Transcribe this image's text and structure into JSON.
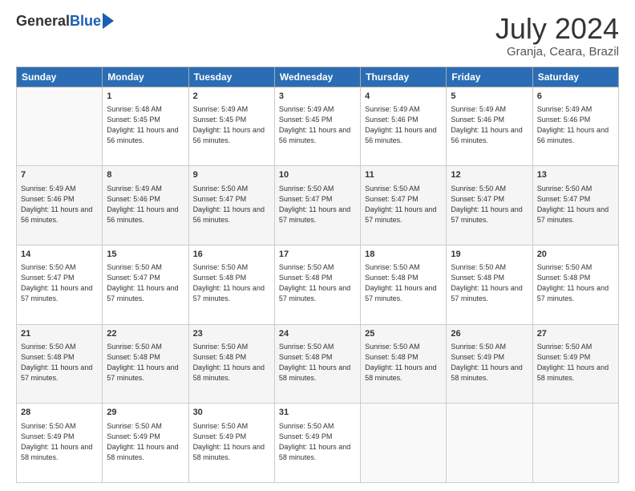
{
  "header": {
    "logo_general": "General",
    "logo_blue": "Blue",
    "month_title": "July 2024",
    "location": "Granja, Ceara, Brazil"
  },
  "days_of_week": [
    "Sunday",
    "Monday",
    "Tuesday",
    "Wednesday",
    "Thursday",
    "Friday",
    "Saturday"
  ],
  "weeks": [
    [
      {
        "day": "",
        "sunrise": "",
        "sunset": "",
        "daylight": ""
      },
      {
        "day": "1",
        "sunrise": "Sunrise: 5:48 AM",
        "sunset": "Sunset: 5:45 PM",
        "daylight": "Daylight: 11 hours and 56 minutes."
      },
      {
        "day": "2",
        "sunrise": "Sunrise: 5:49 AM",
        "sunset": "Sunset: 5:45 PM",
        "daylight": "Daylight: 11 hours and 56 minutes."
      },
      {
        "day": "3",
        "sunrise": "Sunrise: 5:49 AM",
        "sunset": "Sunset: 5:45 PM",
        "daylight": "Daylight: 11 hours and 56 minutes."
      },
      {
        "day": "4",
        "sunrise": "Sunrise: 5:49 AM",
        "sunset": "Sunset: 5:46 PM",
        "daylight": "Daylight: 11 hours and 56 minutes."
      },
      {
        "day": "5",
        "sunrise": "Sunrise: 5:49 AM",
        "sunset": "Sunset: 5:46 PM",
        "daylight": "Daylight: 11 hours and 56 minutes."
      },
      {
        "day": "6",
        "sunrise": "Sunrise: 5:49 AM",
        "sunset": "Sunset: 5:46 PM",
        "daylight": "Daylight: 11 hours and 56 minutes."
      }
    ],
    [
      {
        "day": "7",
        "sunrise": "Sunrise: 5:49 AM",
        "sunset": "Sunset: 5:46 PM",
        "daylight": "Daylight: 11 hours and 56 minutes."
      },
      {
        "day": "8",
        "sunrise": "Sunrise: 5:49 AM",
        "sunset": "Sunset: 5:46 PM",
        "daylight": "Daylight: 11 hours and 56 minutes."
      },
      {
        "day": "9",
        "sunrise": "Sunrise: 5:50 AM",
        "sunset": "Sunset: 5:47 PM",
        "daylight": "Daylight: 11 hours and 56 minutes."
      },
      {
        "day": "10",
        "sunrise": "Sunrise: 5:50 AM",
        "sunset": "Sunset: 5:47 PM",
        "daylight": "Daylight: 11 hours and 57 minutes."
      },
      {
        "day": "11",
        "sunrise": "Sunrise: 5:50 AM",
        "sunset": "Sunset: 5:47 PM",
        "daylight": "Daylight: 11 hours and 57 minutes."
      },
      {
        "day": "12",
        "sunrise": "Sunrise: 5:50 AM",
        "sunset": "Sunset: 5:47 PM",
        "daylight": "Daylight: 11 hours and 57 minutes."
      },
      {
        "day": "13",
        "sunrise": "Sunrise: 5:50 AM",
        "sunset": "Sunset: 5:47 PM",
        "daylight": "Daylight: 11 hours and 57 minutes."
      }
    ],
    [
      {
        "day": "14",
        "sunrise": "Sunrise: 5:50 AM",
        "sunset": "Sunset: 5:47 PM",
        "daylight": "Daylight: 11 hours and 57 minutes."
      },
      {
        "day": "15",
        "sunrise": "Sunrise: 5:50 AM",
        "sunset": "Sunset: 5:47 PM",
        "daylight": "Daylight: 11 hours and 57 minutes."
      },
      {
        "day": "16",
        "sunrise": "Sunrise: 5:50 AM",
        "sunset": "Sunset: 5:48 PM",
        "daylight": "Daylight: 11 hours and 57 minutes."
      },
      {
        "day": "17",
        "sunrise": "Sunrise: 5:50 AM",
        "sunset": "Sunset: 5:48 PM",
        "daylight": "Daylight: 11 hours and 57 minutes."
      },
      {
        "day": "18",
        "sunrise": "Sunrise: 5:50 AM",
        "sunset": "Sunset: 5:48 PM",
        "daylight": "Daylight: 11 hours and 57 minutes."
      },
      {
        "day": "19",
        "sunrise": "Sunrise: 5:50 AM",
        "sunset": "Sunset: 5:48 PM",
        "daylight": "Daylight: 11 hours and 57 minutes."
      },
      {
        "day": "20",
        "sunrise": "Sunrise: 5:50 AM",
        "sunset": "Sunset: 5:48 PM",
        "daylight": "Daylight: 11 hours and 57 minutes."
      }
    ],
    [
      {
        "day": "21",
        "sunrise": "Sunrise: 5:50 AM",
        "sunset": "Sunset: 5:48 PM",
        "daylight": "Daylight: 11 hours and 57 minutes."
      },
      {
        "day": "22",
        "sunrise": "Sunrise: 5:50 AM",
        "sunset": "Sunset: 5:48 PM",
        "daylight": "Daylight: 11 hours and 57 minutes."
      },
      {
        "day": "23",
        "sunrise": "Sunrise: 5:50 AM",
        "sunset": "Sunset: 5:48 PM",
        "daylight": "Daylight: 11 hours and 58 minutes."
      },
      {
        "day": "24",
        "sunrise": "Sunrise: 5:50 AM",
        "sunset": "Sunset: 5:48 PM",
        "daylight": "Daylight: 11 hours and 58 minutes."
      },
      {
        "day": "25",
        "sunrise": "Sunrise: 5:50 AM",
        "sunset": "Sunset: 5:48 PM",
        "daylight": "Daylight: 11 hours and 58 minutes."
      },
      {
        "day": "26",
        "sunrise": "Sunrise: 5:50 AM",
        "sunset": "Sunset: 5:49 PM",
        "daylight": "Daylight: 11 hours and 58 minutes."
      },
      {
        "day": "27",
        "sunrise": "Sunrise: 5:50 AM",
        "sunset": "Sunset: 5:49 PM",
        "daylight": "Daylight: 11 hours and 58 minutes."
      }
    ],
    [
      {
        "day": "28",
        "sunrise": "Sunrise: 5:50 AM",
        "sunset": "Sunset: 5:49 PM",
        "daylight": "Daylight: 11 hours and 58 minutes."
      },
      {
        "day": "29",
        "sunrise": "Sunrise: 5:50 AM",
        "sunset": "Sunset: 5:49 PM",
        "daylight": "Daylight: 11 hours and 58 minutes."
      },
      {
        "day": "30",
        "sunrise": "Sunrise: 5:50 AM",
        "sunset": "Sunset: 5:49 PM",
        "daylight": "Daylight: 11 hours and 58 minutes."
      },
      {
        "day": "31",
        "sunrise": "Sunrise: 5:50 AM",
        "sunset": "Sunset: 5:49 PM",
        "daylight": "Daylight: 11 hours and 58 minutes."
      },
      {
        "day": "",
        "sunrise": "",
        "sunset": "",
        "daylight": ""
      },
      {
        "day": "",
        "sunrise": "",
        "sunset": "",
        "daylight": ""
      },
      {
        "day": "",
        "sunrise": "",
        "sunset": "",
        "daylight": ""
      }
    ]
  ]
}
